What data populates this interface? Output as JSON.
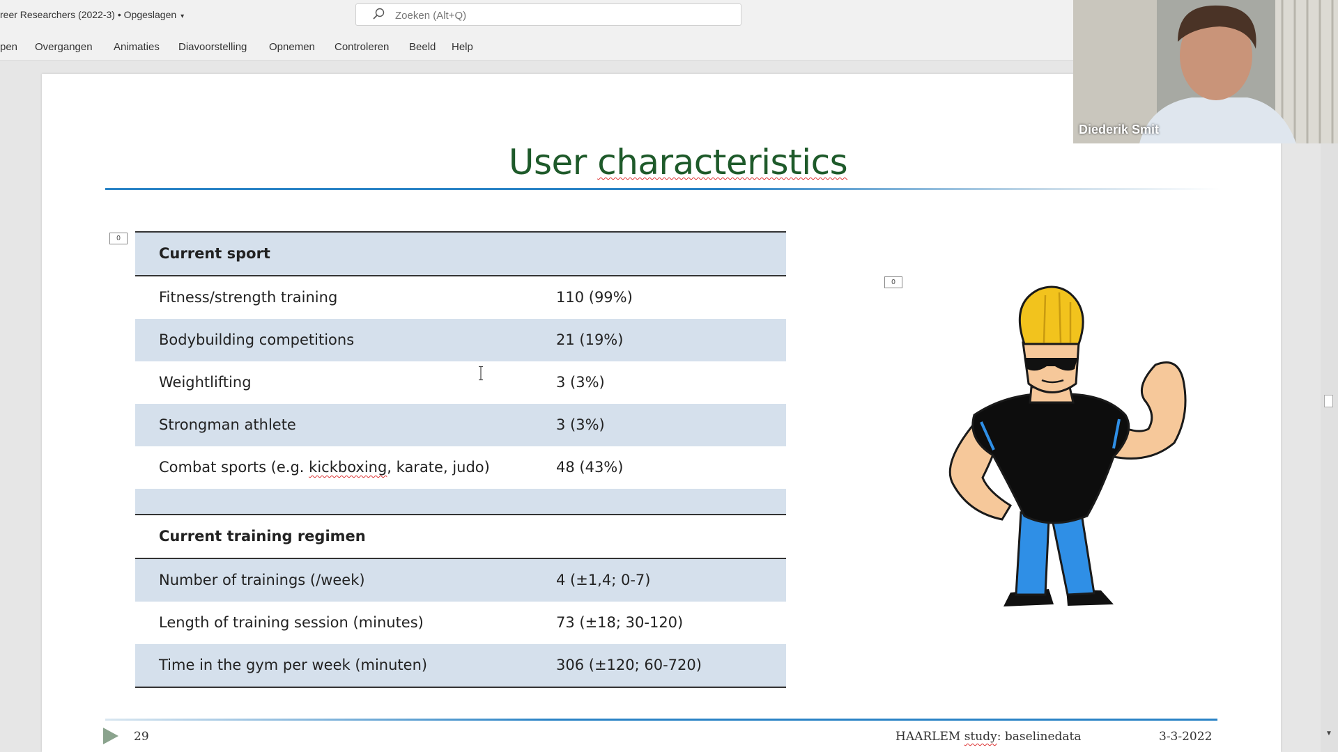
{
  "window": {
    "doc_title": "reer Researchers (2022-3) • Opgeslagen",
    "save_caret": "▾"
  },
  "search": {
    "placeholder": "Zoeken (Alt+Q)"
  },
  "ribbon": {
    "tabs": [
      "pen",
      "Overgangen",
      "Animaties",
      "Diavoorstelling",
      "Opnemen",
      "Controleren",
      "Beeld",
      "Help"
    ]
  },
  "slide": {
    "title_word1": "User",
    "title_word2": "characteristics",
    "marker_label": "0",
    "table": {
      "section1_header": "Current sport",
      "section1_rows": [
        {
          "label": "Fitness/strength training",
          "value": "110 (99%)"
        },
        {
          "label": "Bodybuilding competitions",
          "value": "21 (19%)"
        },
        {
          "label": "Weightlifting",
          "value": "3 (3%)"
        },
        {
          "label": "Strongman athlete",
          "value": "3 (3%)"
        },
        {
          "label_pre": "Combat sports (e.g. ",
          "label_squiggle": "kickboxing",
          "label_post": ", karate, judo)",
          "value": "48 (43%)"
        }
      ],
      "section2_header": "Current training regimen",
      "section2_rows": [
        {
          "label": "Number of trainings (/week)",
          "value": "4 (±1,4; 0-7)"
        },
        {
          "label": "Length of training session (minutes)",
          "value": "73 (±18; 30-120)"
        },
        {
          "label": "Time in the gym per week (minuten)",
          "value": "306 (±120; 60-720)"
        }
      ]
    },
    "footer": {
      "slide_number": "29",
      "text_pre": "HAARLEM ",
      "text_squiggle": "study",
      "text_post": ": baselinedata",
      "date": "3-3-2022"
    }
  },
  "video": {
    "participant_name": "Diederik Smit"
  },
  "colors": {
    "title_green": "#1e5a2a",
    "rule_blue": "#2a83c6",
    "row_shade": "#d5e0ec"
  },
  "icons": [
    "search-icon",
    "play-icon",
    "mascot-illustration",
    "text-cursor-icon"
  ]
}
